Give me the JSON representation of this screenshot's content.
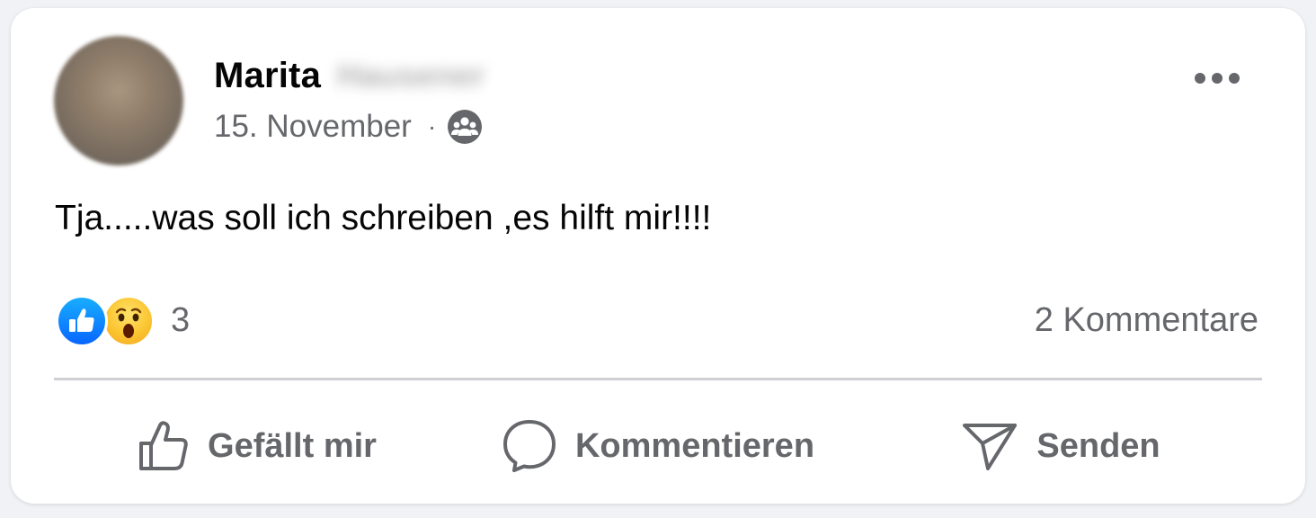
{
  "post": {
    "author": {
      "first_name": "Marita",
      "last_name_redacted": "Hausener"
    },
    "date": "15. November",
    "separator": "·",
    "audience_icon": "group-audience-icon",
    "text": "Tja.....was soll ich schreiben ,es hilft mir!!!!",
    "reactions": {
      "types": [
        "like",
        "wow"
      ],
      "count": "3"
    },
    "comments_label": "2 Kommentare"
  },
  "actions": {
    "like_label": "Gefällt mir",
    "comment_label": "Kommentieren",
    "share_label": "Senden"
  },
  "colors": {
    "text_primary": "#050505",
    "text_secondary": "#65676b",
    "like_blue": "#0866ff",
    "wow_yellow": "#fbc531",
    "divider": "#ced0d4",
    "card_bg": "#ffffff"
  }
}
